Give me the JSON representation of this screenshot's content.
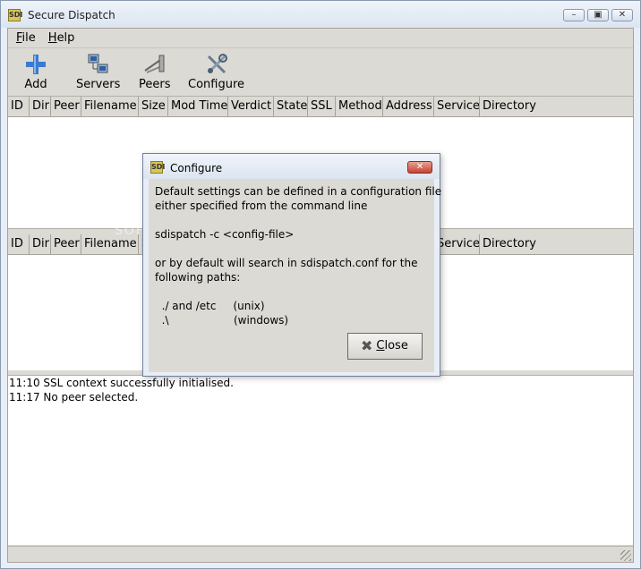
{
  "window": {
    "title": "Secure Dispatch",
    "app_icon": "SDI"
  },
  "menu": [
    {
      "label": "File",
      "accel": "F",
      "rest": "ile"
    },
    {
      "label": "Help",
      "accel": "H",
      "rest": "elp"
    }
  ],
  "toolbar": [
    {
      "label": "Add",
      "icon": "plus-icon"
    },
    {
      "label": "Servers",
      "icon": "servers-icon"
    },
    {
      "label": "Peers",
      "icon": "peers-icon"
    },
    {
      "label": "Configure",
      "icon": "configure-icon"
    }
  ],
  "columns": [
    "ID",
    "Dir",
    "Peer",
    "Filename",
    "Size",
    "Mod Time",
    "Verdict",
    "State",
    "SSL",
    "Method",
    "Address",
    "Service",
    "Directory"
  ],
  "log": [
    "11:10 SSL context successfully initialised.",
    "11:17 No peer selected."
  ],
  "dialog": {
    "title": "Configure",
    "lines": [
      "Default settings can be defined in a configuration file",
      "either specified from the command line",
      "",
      "sdispatch -c <config-file>",
      "",
      "or by default will search in sdispatch.conf for the",
      "following paths:",
      "",
      "  ./ and /etc     (unix)",
      "  .\\                   (windows)"
    ],
    "close": {
      "accel": "C",
      "rest": "lose"
    }
  },
  "watermark": "SOFTPEDIA"
}
